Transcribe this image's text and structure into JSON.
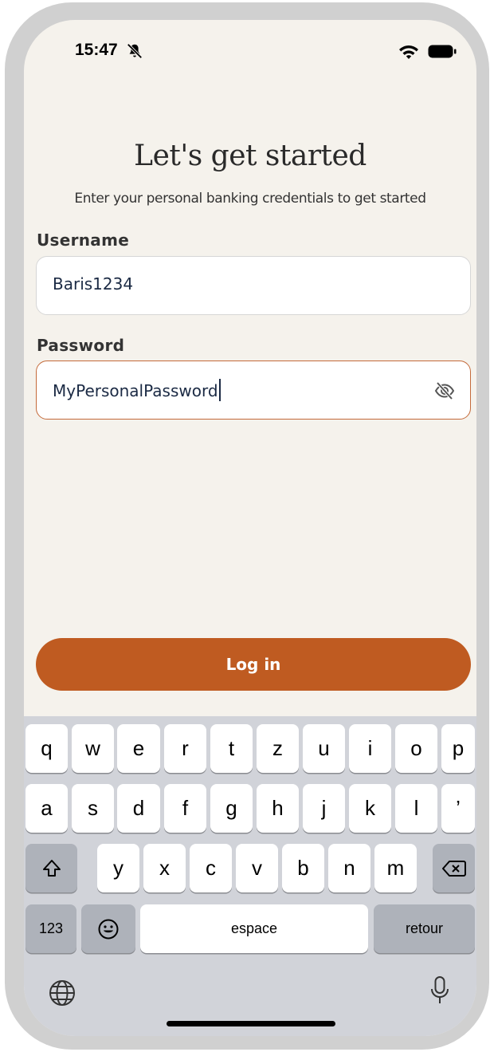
{
  "status_bar": {
    "time": "15:47",
    "icons": [
      "bell-slash-icon",
      "wifi-icon",
      "battery-icon"
    ]
  },
  "header": {
    "title": "Let's get started",
    "subtitle": "Enter your personal banking credentials to get started"
  },
  "form": {
    "username_label": "Username",
    "username_value": "Baris1234",
    "password_label": "Password",
    "password_value": "MyPersonalPassword",
    "password_toggle_icon": "eye-slash-icon"
  },
  "login_button": {
    "label": "Log in"
  },
  "colors": {
    "accent": "#bf5b21",
    "background": "#f5f2ec",
    "focus_border": "#c46a3a"
  },
  "keyboard": {
    "row1": [
      "q",
      "w",
      "e",
      "r",
      "t",
      "z",
      "u",
      "i",
      "o",
      "p"
    ],
    "row2": [
      "a",
      "s",
      "d",
      "f",
      "g",
      "h",
      "j",
      "k",
      "l",
      "’"
    ],
    "row3": [
      "y",
      "x",
      "c",
      "v",
      "b",
      "n",
      "m"
    ],
    "numbers_label": "123",
    "space_label": "espace",
    "return_label": "retour",
    "icons": [
      "shift-icon",
      "backspace-icon",
      "emoji-icon",
      "globe-icon",
      "microphone-icon"
    ]
  }
}
